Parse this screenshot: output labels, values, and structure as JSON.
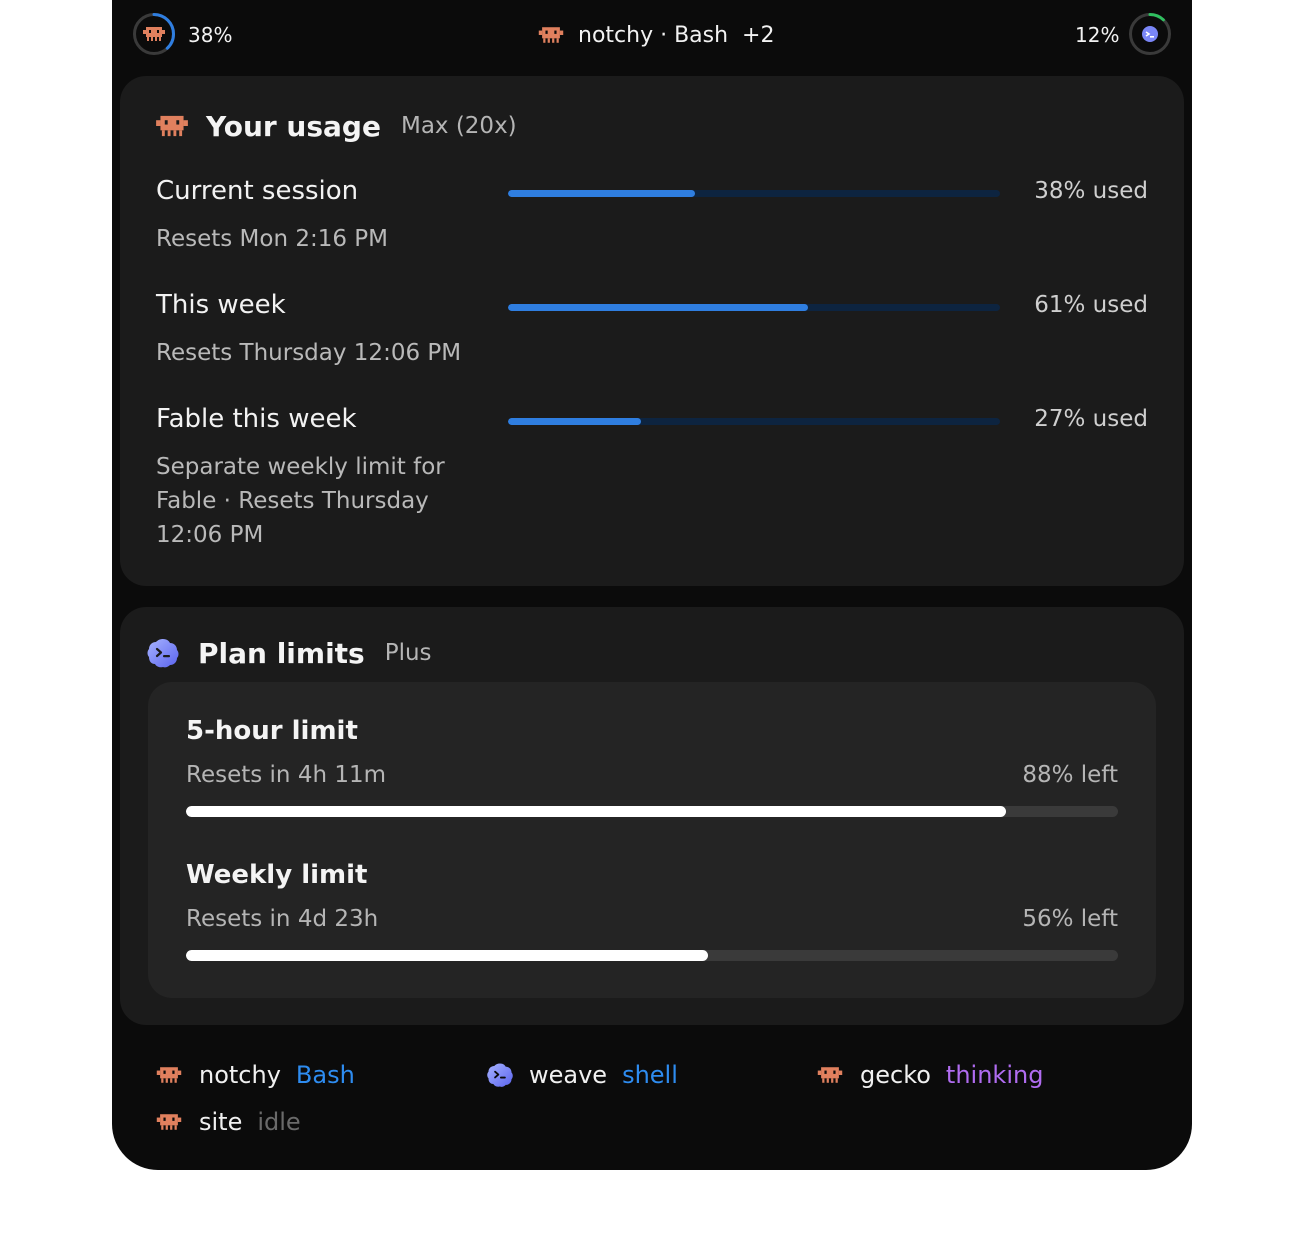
{
  "colors": {
    "accent_blue": "#2f7ee0",
    "status_bash": "#2e8cf0",
    "status_shell": "#2e8cf0",
    "status_thinking": "#b06cf0",
    "status_idle": "#6a6a6a",
    "claude_icon": "#e0805e",
    "codex_icon": "#7a86f7",
    "ring_right": "#2fbf5f"
  },
  "topbar": {
    "left_percent": "38%",
    "left_progress": 0.38,
    "right_percent": "12%",
    "right_progress": 0.12,
    "session_name": "notchy · Bash",
    "extra_count": "+2"
  },
  "usage": {
    "title": "Your usage",
    "plan": "Max (20x)",
    "rows": [
      {
        "label": "Current session",
        "note": "Resets Mon 2:16 PM",
        "used_label": "38% used",
        "fraction": 0.38
      },
      {
        "label": "This week",
        "note": "Resets Thursday 12:06 PM",
        "used_label": "61% used",
        "fraction": 0.61
      },
      {
        "label": "Fable this week",
        "note": "Separate weekly limit for Fable · Resets Thursday 12:06 PM",
        "used_label": "27% used",
        "fraction": 0.27
      }
    ]
  },
  "plan": {
    "title": "Plan limits",
    "tier": "Plus",
    "limits": [
      {
        "title": "5-hour limit",
        "reset": "Resets in 4h 11m",
        "left_label": "88% left",
        "fraction": 0.88
      },
      {
        "title": "Weekly limit",
        "reset": "Resets in 4d 23h",
        "left_label": "56% left",
        "fraction": 0.56
      }
    ]
  },
  "agents": [
    {
      "name": "notchy",
      "status": "Bash",
      "icon": "claude-icon"
    },
    {
      "name": "weave",
      "status": "shell",
      "icon": "codex-icon"
    },
    {
      "name": "gecko",
      "status": "thinking",
      "icon": "claude-icon"
    },
    {
      "name": "site",
      "status": "idle",
      "icon": "claude-icon"
    }
  ]
}
